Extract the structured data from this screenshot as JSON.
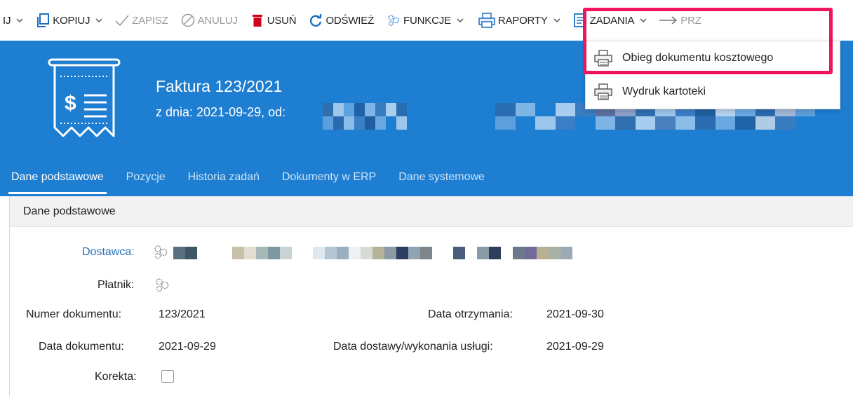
{
  "toolbar": {
    "cut_prefix": "IJ",
    "copy": "KOPIUJ",
    "save": "ZAPISZ",
    "cancel": "ANULUJ",
    "delete": "USUŃ",
    "refresh": "ODŚWIEŻ",
    "functions": "FUNKCJE",
    "reports": "RAPORTY",
    "tasks": "ZADANIA",
    "next": "PRZ"
  },
  "reports_menu": {
    "items": [
      {
        "label": "Obieg dokumentu kosztowego",
        "icon": "printer-icon"
      },
      {
        "label": "Wydruk kartoteki",
        "icon": "printer-icon"
      }
    ]
  },
  "header": {
    "title": "Faktura 123/2021",
    "subtitle": "z dnia: 2021-09-29, od:"
  },
  "tabs": [
    "Dane podstawowe",
    "Pozycje",
    "Historia zadań",
    "Dokumenty w ERP",
    "Dane systemowe"
  ],
  "section": {
    "title": "Dane podstawowe"
  },
  "form": {
    "supplier_label": "Dostawca:",
    "payer_label": "Płatnik:",
    "doc_number_label": "Numer dokumentu:",
    "doc_number_value": "123/2021",
    "received_label": "Data otrzymania:",
    "received_value": "2021-09-30",
    "doc_date_label": "Data dokumentu:",
    "doc_date_value": "2021-09-29",
    "delivery_label": "Data dostawy/wykonania usługi:",
    "delivery_value": "2021-09-29",
    "correction_label": "Korekta:",
    "correction_checked": false
  },
  "colors": {
    "header_bg": "#1e7ed1",
    "highlight": "#f0155a",
    "link": "#2a6fb8"
  }
}
